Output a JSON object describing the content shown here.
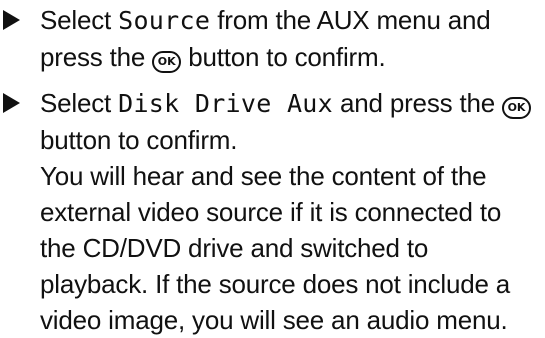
{
  "steps": [
    {
      "bullet_icon": "triangle-right-icon",
      "prefix": "Select ",
      "menu_item": "Source",
      "middle": " from the AUX menu and",
      "line2_prefix": "press the ",
      "button_label": "OK",
      "button_icon": "ok-button-icon",
      "suffix": " button to confirm."
    },
    {
      "bullet_icon": "triangle-right-icon",
      "prefix": "Select ",
      "menu_item": "Disk Drive Aux",
      "middle": " and press the ",
      "button_label": "OK",
      "button_icon": "ok-button-icon",
      "line2": "button to confirm.",
      "result_lines": [
        "You will hear and see the content of the",
        "external video source if it is connected to",
        "the CD/DVD drive and switched to",
        "playback. If the source does not include a",
        "video image, you will see an audio menu."
      ]
    }
  ]
}
